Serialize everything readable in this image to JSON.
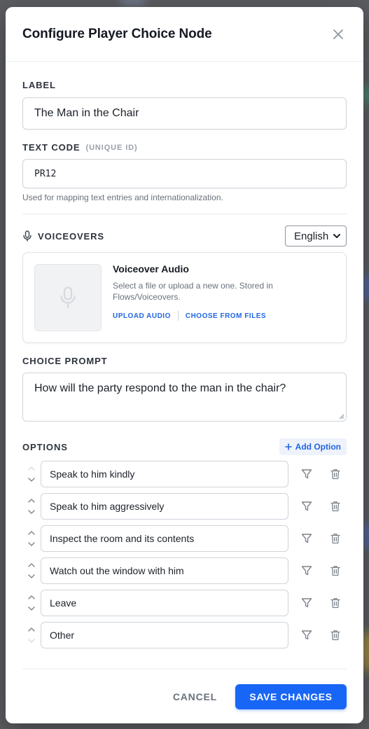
{
  "dialog": {
    "title": "Configure Player Choice Node"
  },
  "label_field": {
    "label": "LABEL",
    "value": "The Man in the Chair"
  },
  "text_code": {
    "label": "TEXT CODE",
    "sublabel": "(UNIQUE ID)",
    "value": "PR12",
    "helper": "Used for mapping text entries and internationalization."
  },
  "voiceovers": {
    "label": "VOICEOVERS",
    "language": "English",
    "card_title": "Voiceover Audio",
    "card_desc": "Select a file or upload a new one. Stored in Flows/Voiceovers.",
    "upload_label": "UPLOAD AUDIO",
    "choose_label": "CHOOSE FROM FILES"
  },
  "choice_prompt": {
    "label": "CHOICE PROMPT",
    "value": "How will the party respond to the man in the chair?"
  },
  "options": {
    "label": "OPTIONS",
    "add_label": "Add Option",
    "items": [
      {
        "text": "Speak to him kindly"
      },
      {
        "text": "Speak to him aggressively"
      },
      {
        "text": "Inspect the room and its contents"
      },
      {
        "text": "Watch out the window with him"
      },
      {
        "text": "Leave"
      },
      {
        "text": "Other"
      }
    ]
  },
  "footer": {
    "cancel_label": "CANCEL",
    "save_label": "SAVE CHANGES"
  },
  "colors": {
    "accent": "#1866f6",
    "link": "#2166e0"
  },
  "icons": {
    "close": "close-icon",
    "mic": "microphone-icon",
    "chevron": "chevron-down-icon",
    "plus": "plus-icon",
    "up": "arrow-up-icon",
    "down": "arrow-down-icon",
    "filter": "filter-icon",
    "trash": "trash-icon"
  }
}
